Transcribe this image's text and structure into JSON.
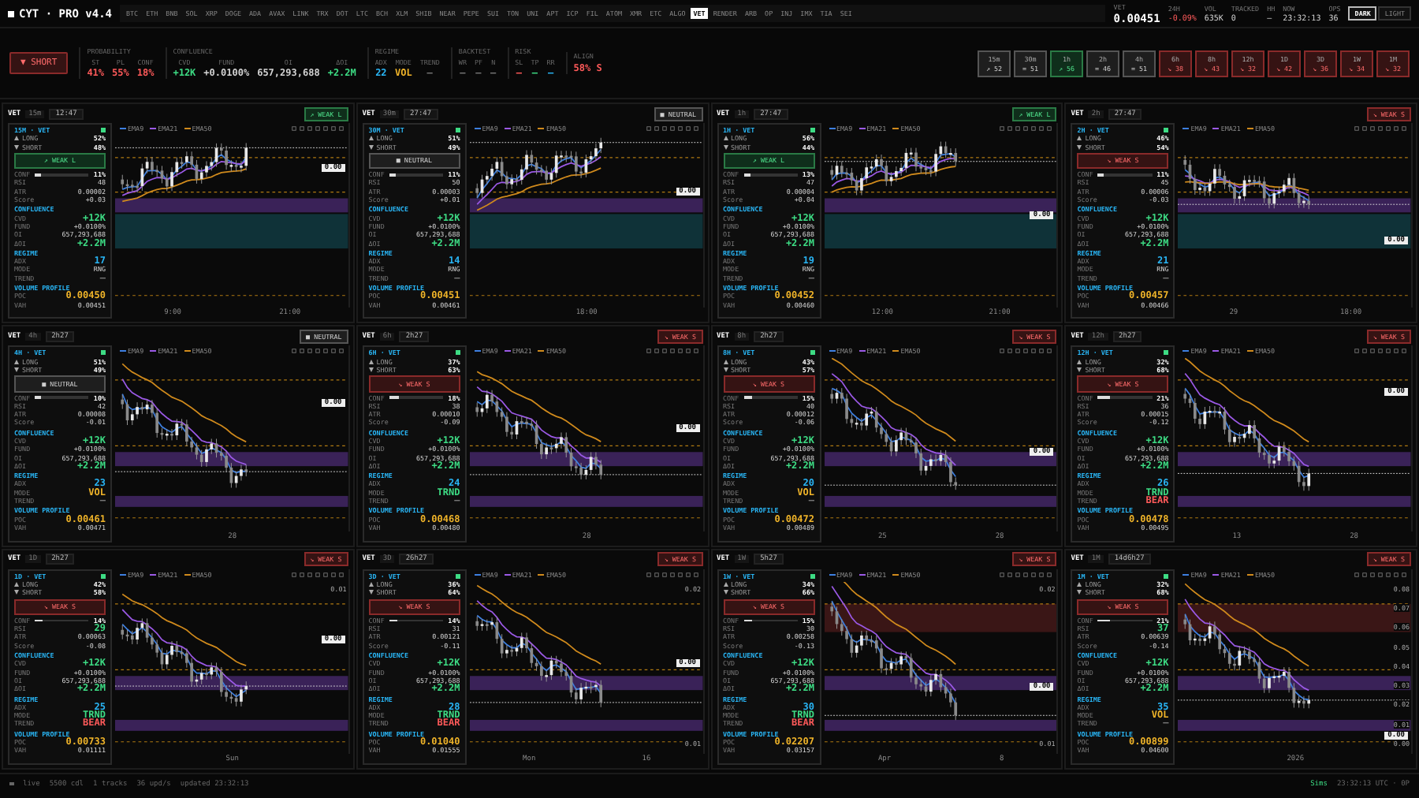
{
  "app": {
    "logo": "CYT · PRO v4.4"
  },
  "symbols": [
    {
      "label": "BTC",
      "selected": false
    },
    {
      "label": "ETH",
      "selected": false
    },
    {
      "label": "BNB",
      "selected": false
    },
    {
      "label": "SOL",
      "selected": false
    },
    {
      "label": "XRP",
      "selected": false
    },
    {
      "label": "DOGE",
      "selected": false
    },
    {
      "label": "ADA",
      "selected": false
    },
    {
      "label": "AVAX",
      "selected": false
    },
    {
      "label": "LINK",
      "selected": false
    },
    {
      "label": "TRX",
      "selected": false
    },
    {
      "label": "DOT",
      "selected": false
    },
    {
      "label": "LTC",
      "selected": false
    },
    {
      "label": "BCH",
      "selected": false
    },
    {
      "label": "XLM",
      "selected": false
    },
    {
      "label": "SHIB",
      "selected": false
    },
    {
      "label": "NEAR",
      "selected": false
    },
    {
      "label": "PEPE",
      "selected": false
    },
    {
      "label": "SUI",
      "selected": false
    },
    {
      "label": "TON",
      "selected": false
    },
    {
      "label": "UNI",
      "selected": false
    },
    {
      "label": "APT",
      "selected": false
    },
    {
      "label": "ICP",
      "selected": false
    },
    {
      "label": "FIL",
      "selected": false
    },
    {
      "label": "ATOM",
      "selected": false
    },
    {
      "label": "XMR",
      "selected": false
    },
    {
      "label": "ETC",
      "selected": false
    },
    {
      "label": "ALGO",
      "selected": false
    },
    {
      "label": "VET",
      "selected": true
    },
    {
      "label": "RENDER",
      "selected": false
    },
    {
      "label": "ARB",
      "selected": false
    },
    {
      "label": "OP",
      "selected": false
    },
    {
      "label": "INJ",
      "selected": false
    },
    {
      "label": "IMX",
      "selected": false
    },
    {
      "label": "TIA",
      "selected": false
    },
    {
      "label": "SEI",
      "selected": false
    }
  ],
  "ticker": [
    {
      "label": "VET",
      "value": "0.00451"
    },
    {
      "label": "24H",
      "value": "-0.09%",
      "color": "#ff5a5a"
    },
    {
      "label": "VOL",
      "value": "635K"
    },
    {
      "label": "TRACKED",
      "value": "0"
    },
    {
      "label": "HH",
      "value": "—"
    },
    {
      "label": "NOW",
      "value": "23:32:13"
    },
    {
      "label": "OPS",
      "value": "36"
    }
  ],
  "theme": [
    {
      "label": "DARK",
      "selected": true
    },
    {
      "label": "LIGHT",
      "selected": false
    }
  ],
  "summary": {
    "signal": "▼ SHORT",
    "kind": "short",
    "groups": [
      {
        "title": "PROBABILITY",
        "items": [
          {
            "label": "ST",
            "value": "41%",
            "color": "#ff5a5a"
          },
          {
            "label": "PL",
            "value": "55%",
            "color": "#ff5a5a"
          },
          {
            "label": "CONF",
            "value": "18%",
            "color": "#ff5a5a"
          }
        ]
      },
      {
        "title": "CONFLUENCE",
        "items": [
          {
            "label": "CVD",
            "value": "+12K",
            "color": "#3ddc84"
          },
          {
            "label": "FUND",
            "value": "+0.0100%"
          },
          {
            "label": "OI",
            "value": "657,293,688"
          },
          {
            "label": "ΔOI",
            "value": "+2.2M",
            "color": "#3ddc84"
          }
        ]
      },
      {
        "title": "REGIME",
        "items": [
          {
            "label": "ADX",
            "value": "22",
            "color": "#29b6f6"
          },
          {
            "label": "MODE",
            "value": "VOL",
            "color": "#f0b429"
          },
          {
            "label": "TREND",
            "value": "—",
            "color": "#777777"
          }
        ]
      },
      {
        "title": "BACKTEST",
        "items": [
          {
            "label": "WR",
            "value": "—",
            "color": "#777777"
          },
          {
            "label": "PF",
            "value": "—",
            "color": "#777777"
          },
          {
            "label": "N",
            "value": "—",
            "color": "#777777"
          }
        ]
      },
      {
        "title": "RISK",
        "items": [
          {
            "label": "SL",
            "value": "—",
            "color": "#ff5a5a"
          },
          {
            "label": "TP",
            "value": "—",
            "color": "#3ddc84"
          },
          {
            "label": "RR",
            "value": "—",
            "color": "#29b6f6"
          }
        ]
      },
      {
        "title": "ALIGN",
        "items": [
          {
            "value": "58% S",
            "color": "#ff5a5a"
          }
        ]
      }
    ]
  },
  "timeframes": [
    {
      "tf": "15m",
      "value": "↗ 52",
      "kind": "neutral"
    },
    {
      "tf": "30m",
      "value": "= 51",
      "kind": "neutral"
    },
    {
      "tf": "1h",
      "value": "↗ 56",
      "kind": "long"
    },
    {
      "tf": "2h",
      "value": "= 46",
      "kind": "neutral"
    },
    {
      "tf": "4h",
      "value": "= 51",
      "kind": "neutral"
    },
    {
      "tf": "6h",
      "value": "↘ 38",
      "kind": "short"
    },
    {
      "tf": "8h",
      "value": "↘ 43",
      "kind": "short"
    },
    {
      "tf": "12h",
      "value": "↘ 32",
      "kind": "short"
    },
    {
      "tf": "1D",
      "value": "↘ 42",
      "kind": "short"
    },
    {
      "tf": "3D",
      "value": "↘ 36",
      "kind": "short"
    },
    {
      "tf": "1W",
      "value": "↘ 34",
      "kind": "short"
    },
    {
      "tf": "1M",
      "value": "↘ 32",
      "kind": "short"
    }
  ],
  "panels": [
    {
      "symbol": "VET",
      "tf": "15m",
      "time": "12:47",
      "kind": "long",
      "badge": "↗ WEAK L",
      "card": {
        "title": "15M · VET",
        "sides": [
          {
            "label": "LONG",
            "value": "52%"
          },
          {
            "label": "SHORT",
            "value": "48%"
          }
        ],
        "signal": "↗ WEAK L",
        "conf": {
          "label": "CONF",
          "value": "11%",
          "level": 0.11
        },
        "stats": [
          {
            "label": "RSI",
            "value": "48"
          },
          {
            "label": "ATR",
            "value": "0.00002"
          },
          {
            "label": "Score",
            "value": "+0.03"
          }
        ],
        "sections": [
          {
            "title": "CONFLUENCE",
            "rows": [
              {
                "label": "CVD",
                "value": "+12K",
                "color": "#3ddc84"
              },
              {
                "label": "FUND",
                "value": "+0.0100%"
              },
              {
                "label": "OI",
                "value": "657,293,688"
              },
              {
                "label": "ΔOI",
                "value": "+2.2M",
                "color": "#3ddc84"
              }
            ]
          },
          {
            "title": "REGIME",
            "rows": [
              {
                "label": "ADX",
                "value": "17",
                "color": "#29b6f6"
              },
              {
                "label": "MODE",
                "value": "RNG"
              },
              {
                "label": "TREND",
                "value": "—",
                "color": "#777777"
              }
            ]
          },
          {
            "title": "VOLUME PROFILE",
            "rows": [
              {
                "label": "POC",
                "value": "0.00450",
                "color": "#f0b429"
              },
              {
                "label": "VAH",
                "value": "0.00451"
              }
            ]
          }
        ]
      },
      "legend": [
        "EMA9",
        "EMA21",
        "EMA50"
      ],
      "x_labels": [
        "9:00",
        "21:00"
      ],
      "price_tag": "0.00"
    },
    {
      "symbol": "VET",
      "tf": "30m",
      "time": "27:47",
      "kind": "neutral",
      "badge": "■ NEUTRAL",
      "card": {
        "title": "30M · VET",
        "sides": [
          {
            "label": "LONG",
            "value": "51%"
          },
          {
            "label": "SHORT",
            "value": "49%"
          }
        ],
        "signal": "■ NEUTRAL",
        "conf": {
          "label": "CONF",
          "value": "11%",
          "level": 0.11
        },
        "stats": [
          {
            "label": "RSI",
            "value": "50"
          },
          {
            "label": "ATR",
            "value": "0.00003"
          },
          {
            "label": "Score",
            "value": "+0.01"
          }
        ],
        "sections": [
          {
            "title": "CONFLUENCE",
            "rows": [
              {
                "label": "CVD",
                "value": "+12K",
                "color": "#3ddc84"
              },
              {
                "label": "FUND",
                "value": "+0.0100%"
              },
              {
                "label": "OI",
                "value": "657,293,688"
              },
              {
                "label": "ΔOI",
                "value": "+2.2M",
                "color": "#3ddc84"
              }
            ]
          },
          {
            "title": "REGIME",
            "rows": [
              {
                "label": "ADX",
                "value": "14",
                "color": "#29b6f6"
              },
              {
                "label": "MODE",
                "value": "RNG"
              },
              {
                "label": "TREND",
                "value": "—",
                "color": "#777777"
              }
            ]
          },
          {
            "title": "VOLUME PROFILE",
            "rows": [
              {
                "label": "POC",
                "value": "0.00451",
                "color": "#f0b429"
              },
              {
                "label": "VAH",
                "value": "0.00461"
              }
            ]
          }
        ]
      },
      "legend": [
        "EMA9",
        "EMA21",
        "EMA50"
      ],
      "x_labels": [
        "18:00"
      ],
      "price_tag": "0.00"
    },
    {
      "symbol": "VET",
      "tf": "1h",
      "time": "27:47",
      "kind": "long",
      "badge": "↗ WEAK L",
      "card": {
        "title": "1H · VET",
        "sides": [
          {
            "label": "LONG",
            "value": "56%"
          },
          {
            "label": "SHORT",
            "value": "44%"
          }
        ],
        "signal": "↗ WEAK L",
        "conf": {
          "label": "CONF",
          "value": "13%",
          "level": 0.13
        },
        "stats": [
          {
            "label": "RSI",
            "value": "47"
          },
          {
            "label": "ATR",
            "value": "0.00004"
          },
          {
            "label": "Score",
            "value": "+0.04"
          }
        ],
        "sections": [
          {
            "title": "CONFLUENCE",
            "rows": [
              {
                "label": "CVD",
                "value": "+12K",
                "color": "#3ddc84"
              },
              {
                "label": "FUND",
                "value": "+0.0100%"
              },
              {
                "label": "OI",
                "value": "657,293,688"
              },
              {
                "label": "ΔOI",
                "value": "+2.2M",
                "color": "#3ddc84"
              }
            ]
          },
          {
            "title": "REGIME",
            "rows": [
              {
                "label": "ADX",
                "value": "19",
                "color": "#29b6f6"
              },
              {
                "label": "MODE",
                "value": "RNG"
              },
              {
                "label": "TREND",
                "value": "—",
                "color": "#777777"
              }
            ]
          },
          {
            "title": "VOLUME PROFILE",
            "rows": [
              {
                "label": "POC",
                "value": "0.00452",
                "color": "#f0b429"
              },
              {
                "label": "VAH",
                "value": "0.00460"
              }
            ]
          }
        ]
      },
      "legend": [
        "EMA9",
        "EMA21",
        "EMA50"
      ],
      "x_labels": [
        "12:00",
        "21:00"
      ],
      "price_tag": "0.00"
    },
    {
      "symbol": "VET",
      "tf": "2h",
      "time": "27:47",
      "kind": "short",
      "badge": "↘ WEAK S",
      "card": {
        "title": "2H · VET",
        "sides": [
          {
            "label": "LONG",
            "value": "46%"
          },
          {
            "label": "SHORT",
            "value": "54%"
          }
        ],
        "signal": "↘ WEAK S",
        "conf": {
          "label": "CONF",
          "value": "11%",
          "level": 0.11
        },
        "stats": [
          {
            "label": "RSI",
            "value": "45"
          },
          {
            "label": "ATR",
            "value": "0.00006"
          },
          {
            "label": "Score",
            "value": "-0.03"
          }
        ],
        "sections": [
          {
            "title": "CONFLUENCE",
            "rows": [
              {
                "label": "CVD",
                "value": "+12K",
                "color": "#3ddc84"
              },
              {
                "label": "FUND",
                "value": "+0.0100%"
              },
              {
                "label": "OI",
                "value": "657,293,688"
              },
              {
                "label": "ΔOI",
                "value": "+2.2M",
                "color": "#3ddc84"
              }
            ]
          },
          {
            "title": "REGIME",
            "rows": [
              {
                "label": "ADX",
                "value": "21",
                "color": "#29b6f6"
              },
              {
                "label": "MODE",
                "value": "RNG"
              },
              {
                "label": "TREND",
                "value": "—",
                "color": "#777777"
              }
            ]
          },
          {
            "title": "VOLUME PROFILE",
            "rows": [
              {
                "label": "POC",
                "value": "0.00457",
                "color": "#f0b429"
              },
              {
                "label": "VAH",
                "value": "0.00466"
              }
            ]
          }
        ]
      },
      "legend": [
        "EMA9",
        "EMA21",
        "EMA50"
      ],
      "x_labels": [
        "29",
        "18:00"
      ],
      "price_tag": "0.00"
    },
    {
      "symbol": "VET",
      "tf": "4h",
      "time": "2h27",
      "kind": "neutral",
      "badge": "■ NEUTRAL",
      "card": {
        "title": "4H · VET",
        "sides": [
          {
            "label": "LONG",
            "value": "51%"
          },
          {
            "label": "SHORT",
            "value": "49%"
          }
        ],
        "signal": "■ NEUTRAL",
        "conf": {
          "label": "CONF",
          "value": "10%",
          "level": 0.1
        },
        "stats": [
          {
            "label": "RSI",
            "value": "42"
          },
          {
            "label": "ATR",
            "value": "0.00008"
          },
          {
            "label": "Score",
            "value": "-0.01"
          }
        ],
        "sections": [
          {
            "title": "CONFLUENCE",
            "rows": [
              {
                "label": "CVD",
                "value": "+12K",
                "color": "#3ddc84"
              },
              {
                "label": "FUND",
                "value": "+0.0100%"
              },
              {
                "label": "OI",
                "value": "657,293,688"
              },
              {
                "label": "ΔOI",
                "value": "+2.2M",
                "color": "#3ddc84"
              }
            ]
          },
          {
            "title": "REGIME",
            "rows": [
              {
                "label": "ADX",
                "value": "23",
                "color": "#29b6f6"
              },
              {
                "label": "MODE",
                "value": "VOL",
                "color": "#f0b429"
              },
              {
                "label": "TREND",
                "value": "—",
                "color": "#777777"
              }
            ]
          },
          {
            "title": "VOLUME PROFILE",
            "rows": [
              {
                "label": "POC",
                "value": "0.00461",
                "color": "#f0b429"
              },
              {
                "label": "VAH",
                "value": "0.00471"
              }
            ]
          }
        ]
      },
      "legend": [
        "EMA9",
        "EMA21",
        "EMA50"
      ],
      "x_labels": [
        "28"
      ],
      "price_tag": "0.00"
    },
    {
      "symbol": "VET",
      "tf": "6h",
      "time": "2h27",
      "kind": "short",
      "badge": "↘ WEAK S",
      "card": {
        "title": "6H · VET",
        "sides": [
          {
            "label": "LONG",
            "value": "37%"
          },
          {
            "label": "SHORT",
            "value": "63%"
          }
        ],
        "signal": "↘ WEAK S",
        "conf": {
          "label": "CONF",
          "value": "18%",
          "level": 0.18
        },
        "stats": [
          {
            "label": "RSI",
            "value": "38"
          },
          {
            "label": "ATR",
            "value": "0.00010"
          },
          {
            "label": "Score",
            "value": "-0.09"
          }
        ],
        "sections": [
          {
            "title": "CONFLUENCE",
            "rows": [
              {
                "label": "CVD",
                "value": "+12K",
                "color": "#3ddc84"
              },
              {
                "label": "FUND",
                "value": "+0.0100%"
              },
              {
                "label": "OI",
                "value": "657,293,688"
              },
              {
                "label": "ΔOI",
                "value": "+2.2M",
                "color": "#3ddc84"
              }
            ]
          },
          {
            "title": "REGIME",
            "rows": [
              {
                "label": "ADX",
                "value": "24",
                "color": "#29b6f6"
              },
              {
                "label": "MODE",
                "value": "TRND",
                "color": "#3ddc84"
              },
              {
                "label": "TREND",
                "value": "—",
                "color": "#777777"
              }
            ]
          },
          {
            "title": "VOLUME PROFILE",
            "rows": [
              {
                "label": "POC",
                "value": "0.00468",
                "color": "#f0b429"
              },
              {
                "label": "VAH",
                "value": "0.00480"
              }
            ]
          }
        ]
      },
      "legend": [
        "EMA9",
        "EMA21",
        "EMA50"
      ],
      "x_labels": [
        "28"
      ],
      "price_tag": "0.00"
    },
    {
      "symbol": "VET",
      "tf": "8h",
      "time": "2h27",
      "kind": "short",
      "badge": "↘ WEAK S",
      "card": {
        "title": "8H · VET",
        "sides": [
          {
            "label": "LONG",
            "value": "43%"
          },
          {
            "label": "SHORT",
            "value": "57%"
          }
        ],
        "signal": "↘ WEAK S",
        "conf": {
          "label": "CONF",
          "value": "15%",
          "level": 0.15
        },
        "stats": [
          {
            "label": "RSI",
            "value": "40"
          },
          {
            "label": "ATR",
            "value": "0.00012"
          },
          {
            "label": "Score",
            "value": "-0.06"
          }
        ],
        "sections": [
          {
            "title": "CONFLUENCE",
            "rows": [
              {
                "label": "CVD",
                "value": "+12K",
                "color": "#3ddc84"
              },
              {
                "label": "FUND",
                "value": "+0.0100%"
              },
              {
                "label": "OI",
                "value": "657,293,688"
              },
              {
                "label": "ΔOI",
                "value": "+2.2M",
                "color": "#3ddc84"
              }
            ]
          },
          {
            "title": "REGIME",
            "rows": [
              {
                "label": "ADX",
                "value": "20",
                "color": "#29b6f6"
              },
              {
                "label": "MODE",
                "value": "VOL",
                "color": "#f0b429"
              },
              {
                "label": "TREND",
                "value": "—",
                "color": "#777777"
              }
            ]
          },
          {
            "title": "VOLUME PROFILE",
            "rows": [
              {
                "label": "POC",
                "value": "0.00472",
                "color": "#f0b429"
              },
              {
                "label": "VAH",
                "value": "0.00489"
              }
            ]
          }
        ]
      },
      "legend": [
        "EMA9",
        "EMA21",
        "EMA50"
      ],
      "x_labels": [
        "25",
        "28"
      ],
      "price_tag": "0.00"
    },
    {
      "symbol": "VET",
      "tf": "12h",
      "time": "2h27",
      "kind": "short",
      "badge": "↘ WEAK S",
      "card": {
        "title": "12H · VET",
        "sides": [
          {
            "label": "LONG",
            "value": "32%"
          },
          {
            "label": "SHORT",
            "value": "68%"
          }
        ],
        "signal": "↘ WEAK S",
        "conf": {
          "label": "CONF",
          "value": "21%",
          "level": 0.21
        },
        "stats": [
          {
            "label": "RSI",
            "value": "36"
          },
          {
            "label": "ATR",
            "value": "0.00015"
          },
          {
            "label": "Score",
            "value": "-0.12"
          }
        ],
        "sections": [
          {
            "title": "CONFLUENCE",
            "rows": [
              {
                "label": "CVD",
                "value": "+12K",
                "color": "#3ddc84"
              },
              {
                "label": "FUND",
                "value": "+0.0100%"
              },
              {
                "label": "OI",
                "value": "657,293,688"
              },
              {
                "label": "ΔOI",
                "value": "+2.2M",
                "color": "#3ddc84"
              }
            ]
          },
          {
            "title": "REGIME",
            "rows": [
              {
                "label": "ADX",
                "value": "26",
                "color": "#29b6f6"
              },
              {
                "label": "MODE",
                "value": "TRND",
                "color": "#3ddc84"
              },
              {
                "label": "TREND",
                "value": "BEAR",
                "color": "#ff5a5a"
              }
            ]
          },
          {
            "title": "VOLUME PROFILE",
            "rows": [
              {
                "label": "POC",
                "value": "0.00478",
                "color": "#f0b429"
              },
              {
                "label": "VAH",
                "value": "0.00495"
              }
            ]
          }
        ]
      },
      "legend": [
        "EMA9",
        "EMA21",
        "EMA50"
      ],
      "x_labels": [
        "13",
        "28"
      ],
      "price_tag": "0.00"
    },
    {
      "symbol": "VET",
      "tf": "1D",
      "time": "2h27",
      "kind": "short",
      "badge": "↘ WEAK S",
      "card": {
        "title": "1D · VET",
        "sides": [
          {
            "label": "LONG",
            "value": "42%"
          },
          {
            "label": "SHORT",
            "value": "58%"
          }
        ],
        "signal": "↘ WEAK S",
        "conf": {
          "label": "CONF",
          "value": "14%",
          "level": 0.14
        },
        "stats": [
          {
            "label": "RSI",
            "value": "29",
            "color": "#3ddc84"
          },
          {
            "label": "ATR",
            "value": "0.00063"
          },
          {
            "label": "Score",
            "value": "-0.08"
          }
        ],
        "sections": [
          {
            "title": "CONFLUENCE",
            "rows": [
              {
                "label": "CVD",
                "value": "+12K",
                "color": "#3ddc84"
              },
              {
                "label": "FUND",
                "value": "+0.0100%"
              },
              {
                "label": "OI",
                "value": "657,293,688"
              },
              {
                "label": "ΔOI",
                "value": "+2.2M",
                "color": "#3ddc84"
              }
            ]
          },
          {
            "title": "REGIME",
            "rows": [
              {
                "label": "ADX",
                "value": "25",
                "color": "#29b6f6"
              },
              {
                "label": "MODE",
                "value": "TRND",
                "color": "#3ddc84"
              },
              {
                "label": "TREND",
                "value": "BEAR",
                "color": "#ff5a5a"
              }
            ]
          },
          {
            "title": "VOLUME PROFILE",
            "rows": [
              {
                "label": "POC",
                "value": "0.00733",
                "color": "#f0b429"
              },
              {
                "label": "VAH",
                "value": "0.01111"
              }
            ]
          }
        ]
      },
      "legend": [
        "EMA9",
        "EMA21",
        "EMA50"
      ],
      "x_labels": [
        "Sun"
      ],
      "axis_labels": [
        "0.01"
      ],
      "price_tag": "0.00"
    },
    {
      "symbol": "VET",
      "tf": "3D",
      "time": "26h27",
      "kind": "short",
      "badge": "↘ WEAK S",
      "card": {
        "title": "3D · VET",
        "sides": [
          {
            "label": "LONG",
            "value": "36%"
          },
          {
            "label": "SHORT",
            "value": "64%"
          }
        ],
        "signal": "↘ WEAK S",
        "conf": {
          "label": "CONF",
          "value": "14%",
          "level": 0.14
        },
        "stats": [
          {
            "label": "RSI",
            "value": "31"
          },
          {
            "label": "ATR",
            "value": "0.00121"
          },
          {
            "label": "Score",
            "value": "-0.11"
          }
        ],
        "sections": [
          {
            "title": "CONFLUENCE",
            "rows": [
              {
                "label": "CVD",
                "value": "+12K",
                "color": "#3ddc84"
              },
              {
                "label": "FUND",
                "value": "+0.0100%"
              },
              {
                "label": "OI",
                "value": "657,293,688"
              },
              {
                "label": "ΔOI",
                "value": "+2.2M",
                "color": "#3ddc84"
              }
            ]
          },
          {
            "title": "REGIME",
            "rows": [
              {
                "label": "ADX",
                "value": "28",
                "color": "#29b6f6"
              },
              {
                "label": "MODE",
                "value": "TRND",
                "color": "#3ddc84"
              },
              {
                "label": "TREND",
                "value": "BEAR",
                "color": "#ff5a5a"
              }
            ]
          },
          {
            "title": "VOLUME PROFILE",
            "rows": [
              {
                "label": "POC",
                "value": "0.01040",
                "color": "#f0b429"
              },
              {
                "label": "VAH",
                "value": "0.01555"
              }
            ]
          }
        ]
      },
      "legend": [
        "EMA9",
        "EMA21",
        "EMA50"
      ],
      "x_labels": [
        "Mon",
        "16"
      ],
      "axis_labels": [
        "0.02",
        "0.01"
      ],
      "price_tag": "0.00"
    },
    {
      "symbol": "VET",
      "tf": "1W",
      "time": "5h27",
      "kind": "short",
      "badge": "↘ WEAK S",
      "card": {
        "title": "1W · VET",
        "sides": [
          {
            "label": "LONG",
            "value": "34%"
          },
          {
            "label": "SHORT",
            "value": "66%"
          }
        ],
        "signal": "↘ WEAK S",
        "conf": {
          "label": "CONF",
          "value": "15%",
          "level": 0.15
        },
        "stats": [
          {
            "label": "RSI",
            "value": "30"
          },
          {
            "label": "ATR",
            "value": "0.00258"
          },
          {
            "label": "Score",
            "value": "-0.13"
          }
        ],
        "sections": [
          {
            "title": "CONFLUENCE",
            "rows": [
              {
                "label": "CVD",
                "value": "+12K",
                "color": "#3ddc84"
              },
              {
                "label": "FUND",
                "value": "+0.0100%"
              },
              {
                "label": "OI",
                "value": "657,293,688"
              },
              {
                "label": "ΔOI",
                "value": "+2.2M",
                "color": "#3ddc84"
              }
            ]
          },
          {
            "title": "REGIME",
            "rows": [
              {
                "label": "ADX",
                "value": "30",
                "color": "#29b6f6"
              },
              {
                "label": "MODE",
                "value": "TRND",
                "color": "#3ddc84"
              },
              {
                "label": "TREND",
                "value": "BEAR",
                "color": "#ff5a5a"
              }
            ]
          },
          {
            "title": "VOLUME PROFILE",
            "rows": [
              {
                "label": "POC",
                "value": "0.02207",
                "color": "#f0b429"
              },
              {
                "label": "VAH",
                "value": "0.03157"
              }
            ]
          }
        ]
      },
      "legend": [
        "EMA9",
        "EMA21",
        "EMA50"
      ],
      "x_labels": [
        "Apr",
        "8"
      ],
      "axis_labels": [
        "0.02",
        "0.01"
      ],
      "price_tag": "0.00"
    },
    {
      "symbol": "VET",
      "tf": "1M",
      "time": "14d6h27",
      "kind": "short",
      "badge": "↘ WEAK S",
      "card": {
        "title": "1M · VET",
        "sides": [
          {
            "label": "LONG",
            "value": "32%"
          },
          {
            "label": "SHORT",
            "value": "68%"
          }
        ],
        "signal": "↘ WEAK S",
        "conf": {
          "label": "CONF",
          "value": "21%",
          "level": 0.21
        },
        "stats": [
          {
            "label": "RSI",
            "value": "37",
            "color": "#3ddc84"
          },
          {
            "label": "ATR",
            "value": "0.00639"
          },
          {
            "label": "Score",
            "value": "-0.14"
          }
        ],
        "sections": [
          {
            "title": "CONFLUENCE",
            "rows": [
              {
                "label": "CVD",
                "value": "+12K",
                "color": "#3ddc84"
              },
              {
                "label": "FUND",
                "value": "+0.0100%"
              },
              {
                "label": "OI",
                "value": "657,293,688"
              },
              {
                "label": "ΔOI",
                "value": "+2.2M",
                "color": "#3ddc84"
              }
            ]
          },
          {
            "title": "REGIME",
            "rows": [
              {
                "label": "ADX",
                "value": "35",
                "color": "#29b6f6"
              },
              {
                "label": "MODE",
                "value": "VOL",
                "color": "#f0b429"
              },
              {
                "label": "TREND",
                "value": "—",
                "color": "#777777"
              }
            ]
          },
          {
            "title": "VOLUME PROFILE",
            "rows": [
              {
                "label": "POC",
                "value": "0.00899",
                "color": "#f0b429"
              },
              {
                "label": "VAH",
                "value": "0.04600"
              }
            ]
          }
        ]
      },
      "legend": [
        "EMA9",
        "EMA21",
        "EMA50"
      ],
      "x_labels": [
        "2026"
      ],
      "axis_labels": [
        "0.08",
        "0.07",
        "0.06",
        "0.05",
        "0.04",
        "0.03",
        "0.02",
        "0.01",
        "0.00"
      ],
      "price_tag": "0.00"
    }
  ],
  "footer": {
    "left": [
      "live",
      "5500 cdl",
      "1 tracks",
      "36 upd/s",
      "updated 23:32:13"
    ],
    "status": "Sims",
    "right": "23:32:13 UTC · 0P"
  }
}
